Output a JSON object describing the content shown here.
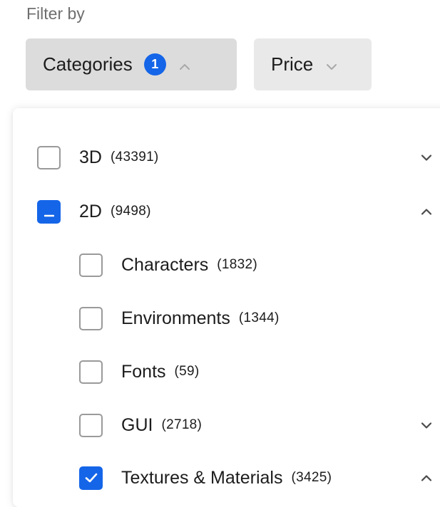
{
  "filter": {
    "label": "Filter by",
    "chips": {
      "categories": {
        "label": "Categories",
        "badge": "1",
        "expanded": true
      },
      "price": {
        "label": "Price",
        "expanded": false
      }
    }
  },
  "colors": {
    "accent": "#1565e8",
    "chip_active_bg": "#dcdcdc",
    "chip_bg": "#e9e9e9",
    "muted_text": "#6f6f6f"
  },
  "categories": {
    "items": [
      {
        "label": "3D",
        "count": "(43391)",
        "state": "unchecked",
        "chevron": "chevron-down-icon"
      },
      {
        "label": "2D",
        "count": "(9498)",
        "state": "indeterminate",
        "chevron": "chevron-up-icon",
        "children": [
          {
            "label": "Characters",
            "count": "(1832)",
            "state": "unchecked"
          },
          {
            "label": "Environments",
            "count": "(1344)",
            "state": "unchecked"
          },
          {
            "label": "Fonts",
            "count": "(59)",
            "state": "unchecked"
          },
          {
            "label": "GUI",
            "count": "(2718)",
            "state": "unchecked",
            "chevron": "chevron-down-icon"
          },
          {
            "label": "Textures & Materials",
            "count": "(3425)",
            "state": "checked",
            "chevron": "chevron-up-icon"
          }
        ]
      }
    ]
  }
}
